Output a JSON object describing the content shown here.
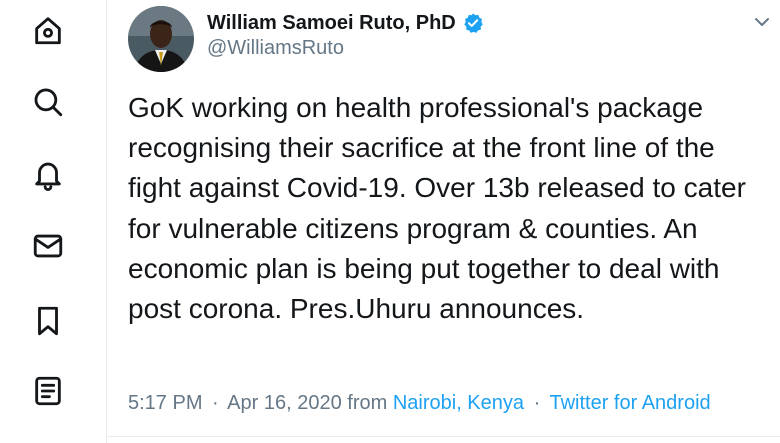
{
  "colors": {
    "text": "#14171a",
    "secondary": "#657786",
    "accent": "#1da1f2",
    "divider": "#e6ecf0"
  },
  "sidebar": {
    "items": [
      {
        "icon": "home-icon"
      },
      {
        "icon": "search-icon"
      },
      {
        "icon": "bell-icon"
      },
      {
        "icon": "mail-icon"
      },
      {
        "icon": "bookmark-icon"
      },
      {
        "icon": "list-icon"
      }
    ]
  },
  "tweet": {
    "author": {
      "display_name": "William Samoei Ruto, PhD",
      "handle": "@WilliamsRuto",
      "verified": true
    },
    "text": "GoK working on health professional's package recognising their sacrifice at the front line of the fight against Covid-19. Over 13b released to cater for vulnerable citizens program & counties. An economic plan is being put together to deal with post corona. Pres.Uhuru announces.",
    "time": "5:17 PM",
    "date": "Apr 16, 2020",
    "from_label": "from",
    "location": "Nairobi, Kenya",
    "source": "Twitter for Android",
    "separator": "·"
  }
}
